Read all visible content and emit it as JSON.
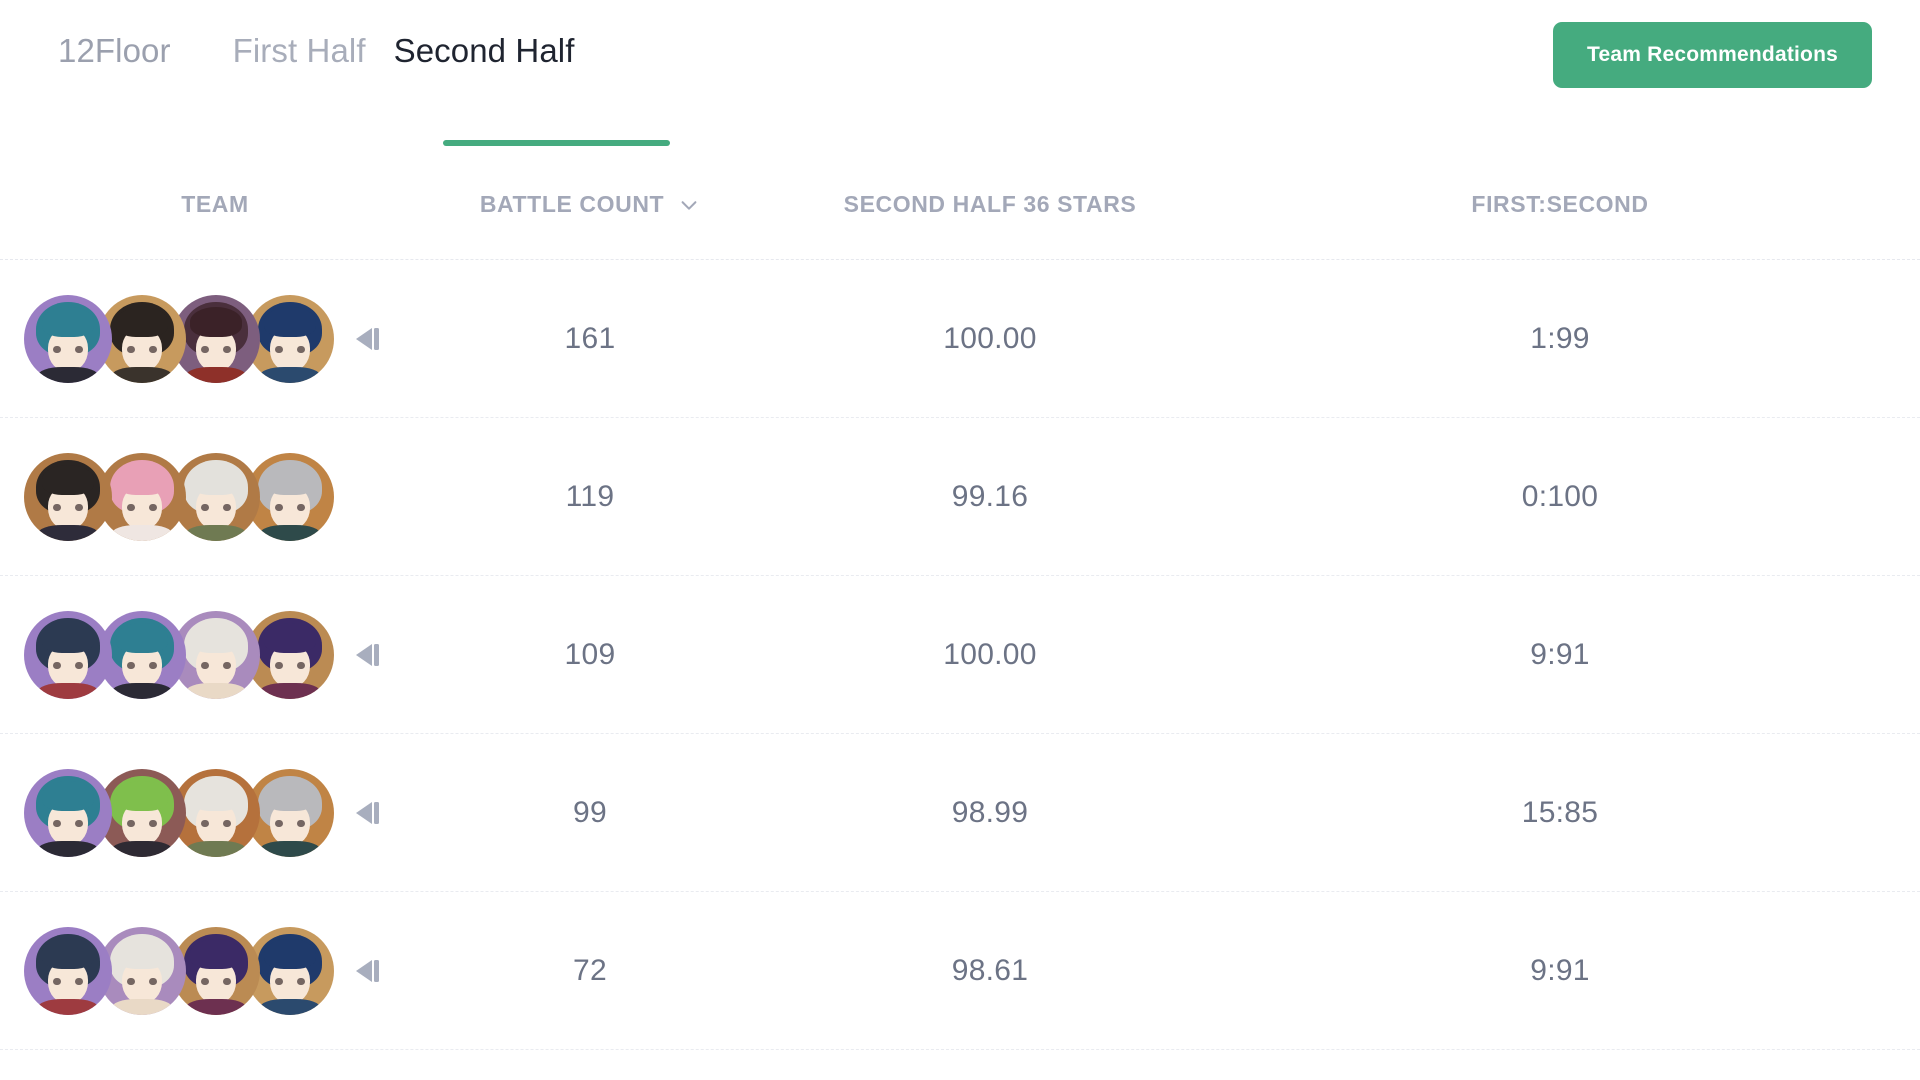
{
  "header": {
    "floor_label": "12Floor",
    "tabs": [
      {
        "label": "First Half",
        "active": false
      },
      {
        "label": "Second Half",
        "active": true
      }
    ],
    "cta_label": "Team Recommendations",
    "cta_color": "#45ab7f",
    "underline_color": "#45ab7f"
  },
  "table": {
    "columns": [
      {
        "key": "team",
        "label": "TEAM",
        "sortable": false
      },
      {
        "key": "count",
        "label": "BATTLE COUNT",
        "sortable": true,
        "sort_icon": "chevron-down-icon"
      },
      {
        "key": "stars",
        "label": "SECOND HALF 36 STARS",
        "sortable": false
      },
      {
        "key": "ratio",
        "label": "FIRST:SECOND",
        "sortable": false
      }
    ],
    "rows": [
      {
        "battle_count": "161",
        "second_half_36_stars": "100.00",
        "first_second": "1:99",
        "has_replay": true,
        "team": [
          {
            "ring": "#9b7ec4",
            "hair": "#2e7f92",
            "fringe": "#2e7f92",
            "body": "#2b2a35"
          },
          {
            "ring": "#c79a5e",
            "hair": "#2b2420",
            "fringe": "#2b2420",
            "body": "#3a332c"
          },
          {
            "ring": "#7d5e7e",
            "hair": "#4a2f3c",
            "fringe": "#3b2228",
            "body": "#8e3029"
          },
          {
            "ring": "#c79a5e",
            "hair": "#1f3a6b",
            "fringe": "#1f3a6b",
            "body": "#2b4a6e"
          }
        ]
      },
      {
        "battle_count": "119",
        "second_half_36_stars": "99.16",
        "first_second": "0:100",
        "has_replay": false,
        "team": [
          {
            "ring": "#b07a46",
            "hair": "#2a2523",
            "fringe": "#2a2523",
            "body": "#2e2c3a"
          },
          {
            "ring": "#b07a46",
            "hair": "#e8a0b6",
            "fringe": "#e8a0b6",
            "body": "#efe6e2"
          },
          {
            "ring": "#b07a46",
            "hair": "#e3e1dc",
            "fringe": "#e3e1dc",
            "body": "#6f7a52"
          },
          {
            "ring": "#c08445",
            "hair": "#b9b9bc",
            "fringe": "#b9b9bc",
            "body": "#2e4a4a"
          }
        ]
      },
      {
        "battle_count": "109",
        "second_half_36_stars": "100.00",
        "first_second": "9:91",
        "has_replay": true,
        "team": [
          {
            "ring": "#9b7ec4",
            "hair": "#2c3a52",
            "fringe": "#2c3a52",
            "body": "#9e3b40"
          },
          {
            "ring": "#9b7ec4",
            "hair": "#2e7f92",
            "fringe": "#2e7f92",
            "body": "#2b2a35"
          },
          {
            "ring": "#a98bbd",
            "hair": "#e6e3dd",
            "fringe": "#e6e3dd",
            "body": "#e9d9c6"
          },
          {
            "ring": "#bb8b53",
            "hair": "#3b2a66",
            "fringe": "#3b2a66",
            "body": "#6d3050"
          }
        ]
      },
      {
        "battle_count": "99",
        "second_half_36_stars": "98.99",
        "first_second": "15:85",
        "has_replay": true,
        "team": [
          {
            "ring": "#9b7ec4",
            "hair": "#2e7f92",
            "fringe": "#2e7f92",
            "body": "#2b2a35"
          },
          {
            "ring": "#8c5a56",
            "hair": "#7fbf4c",
            "fringe": "#7fbf4c",
            "body": "#2e2a33"
          },
          {
            "ring": "#b5713c",
            "hair": "#e6e3dd",
            "fringe": "#e6e3dd",
            "body": "#6f7a52"
          },
          {
            "ring": "#c08445",
            "hair": "#b9b9bc",
            "fringe": "#b9b9bc",
            "body": "#2e4a4a"
          }
        ]
      },
      {
        "battle_count": "72",
        "second_half_36_stars": "98.61",
        "first_second": "9:91",
        "has_replay": true,
        "team": [
          {
            "ring": "#9b7ec4",
            "hair": "#2c3a52",
            "fringe": "#2c3a52",
            "body": "#9e3b40"
          },
          {
            "ring": "#a98bbd",
            "hair": "#e6e3dd",
            "fringe": "#e6e3dd",
            "body": "#e9d9c6"
          },
          {
            "ring": "#bb8b53",
            "hair": "#3b2a66",
            "fringe": "#3b2a66",
            "body": "#6d3050"
          },
          {
            "ring": "#c79a5e",
            "hair": "#1f3a6b",
            "fringe": "#1f3a6b",
            "body": "#2b4a6e"
          }
        ]
      }
    ]
  },
  "icons": {
    "sort_caret": "chevron-down-icon",
    "replay": "replay-rewind-icon"
  }
}
